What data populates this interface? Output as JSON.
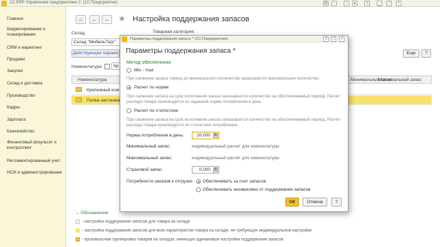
{
  "app": {
    "title": "1С:ERP Управление предприятием 2. (1С:Предприятие)"
  },
  "titlebar_icons": [
    "folder-icon",
    "star-icon",
    "info-icon",
    "bell-icon",
    "settings-icon",
    "minimize-icon",
    "restore-icon",
    "close-icon"
  ],
  "sidebar": {
    "items": [
      {
        "label": "Главное"
      },
      {
        "label": "Бюджетирование и планирование"
      },
      {
        "label": "CRM и маркетинг"
      },
      {
        "label": "Продажи"
      },
      {
        "label": "Закупки"
      },
      {
        "label": "Склад и доставка"
      },
      {
        "label": "Производство"
      },
      {
        "label": "Кадры"
      },
      {
        "label": "Зарплата"
      },
      {
        "label": "Казначейство"
      },
      {
        "label": "Финансовый результат и контроллинг"
      },
      {
        "label": "Регламентированный учет"
      },
      {
        "label": "НСИ и администрирование"
      }
    ]
  },
  "page": {
    "title": "Настройка поддержания запасов",
    "warehouse_label": "Склад:",
    "warehouse_value": "Склад \"МебельТорг\"",
    "category_label": "Товарная категория:",
    "action_button": "Действующие параме",
    "more_button": "Еще",
    "help_button": "?",
    "nomenclature_label": "Номенклатура:",
    "nomenclature_value": "Кр"
  },
  "table": {
    "columns": [
      "Номенклатура",
      "Минимальный запас",
      "Максимальный запас"
    ],
    "rows": [
      {
        "name": "Крепежный ком"
      },
      {
        "name": "Полка настенна"
      }
    ]
  },
  "legend": {
    "title": "Обозначения",
    "items": [
      "- настройка поддержания запасов для товара на складе",
      "- настройка поддержания запасов для всех характеристик товара на складе, не требующих индивидуальной настройки",
      "- произвольная группировка товаров на складах, имеющих одинаковые настройки поддержания запасов"
    ],
    "colors": [
      "#ffffff",
      "#f7e36c",
      "#f0c34c"
    ]
  },
  "dialog": {
    "window_title": "Параметры поддержания запаса * (1С:Предприятие)",
    "title": "Параметры поддержания запаса *",
    "method_heading": "Метод обеспечения",
    "options": [
      {
        "label": "Min - max",
        "note": "При снижении запаса товара до минимального количества заказывается максимальное количество.",
        "selected": false
      },
      {
        "label": "Расчет по норме",
        "note": "При снижении запаса на срок исполнения заказа заказывается количество на обеспечиваемый период. Расчет расхода товара производится по заданной норме потребления в день.",
        "selected": true
      },
      {
        "label": "Расчет по статистике",
        "note": "При снижении запаса на срок исполнения заказа заказывается количество на обеспечиваемый период. Расчет расхода товара производится по статистике потребления.",
        "selected": false
      }
    ],
    "norm_label": "Норма потребления в день:",
    "norm_value": "20,000",
    "min_label": "Минимальный запас:",
    "min_value": "индивидуальный расчет для номенклатуры",
    "max_label": "Максимальный запас:",
    "max_value": "индивидуальный расчет для номенклатуры",
    "safety_label": "Страховой запас:",
    "safety_value": "0,000",
    "needs_label": "Потребности заказов к отгрузке:",
    "needs_options": [
      {
        "label": "Обеспечивать за счет запасов",
        "selected": true
      },
      {
        "label": "Обеспечивать независимо от поддержания запасов",
        "selected": false
      }
    ],
    "ok": "ОК",
    "cancel": "Отмена",
    "help": "?"
  }
}
